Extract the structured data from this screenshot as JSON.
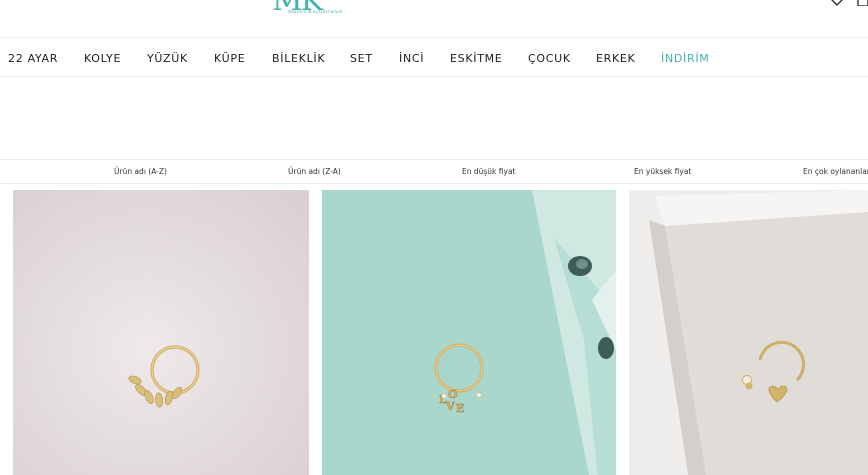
{
  "header": {
    "logo_text": "MK",
    "logo_subtitle": "Mücev Kuyumculuk",
    "favorites_icon": "heart-icon",
    "cart_icon": "bag-icon"
  },
  "nav": {
    "items": [
      "22 AYAR",
      "KOLYE",
      "YÜZÜK",
      "KÜPE",
      "BİLEKLİK",
      "SET",
      "İNCİ",
      "ESKİTME",
      "ÇOCUK",
      "ERKEK",
      "İNDİRİM"
    ],
    "sale_color": "#3fb3ad"
  },
  "sort": {
    "options": [
      "Ürün adı (A-Z)",
      "Ürün adı (Z-A)",
      "En düşük fiyat",
      "En yüksek fiyat",
      "En çok oylananlar"
    ]
  },
  "products": [
    {
      "image": "gold-leaf-hoop-piercing",
      "background": "#e6dfe1"
    },
    {
      "image": "gold-love-hoop-piercing",
      "background": "#a9d7cc"
    },
    {
      "image": "gold-heart-horseshoe-piercing",
      "background": "#ece9e6"
    }
  ],
  "colors": {
    "brand": "#3fb3ad",
    "gold": "#d4b46a",
    "text": "#1d1d1d"
  }
}
